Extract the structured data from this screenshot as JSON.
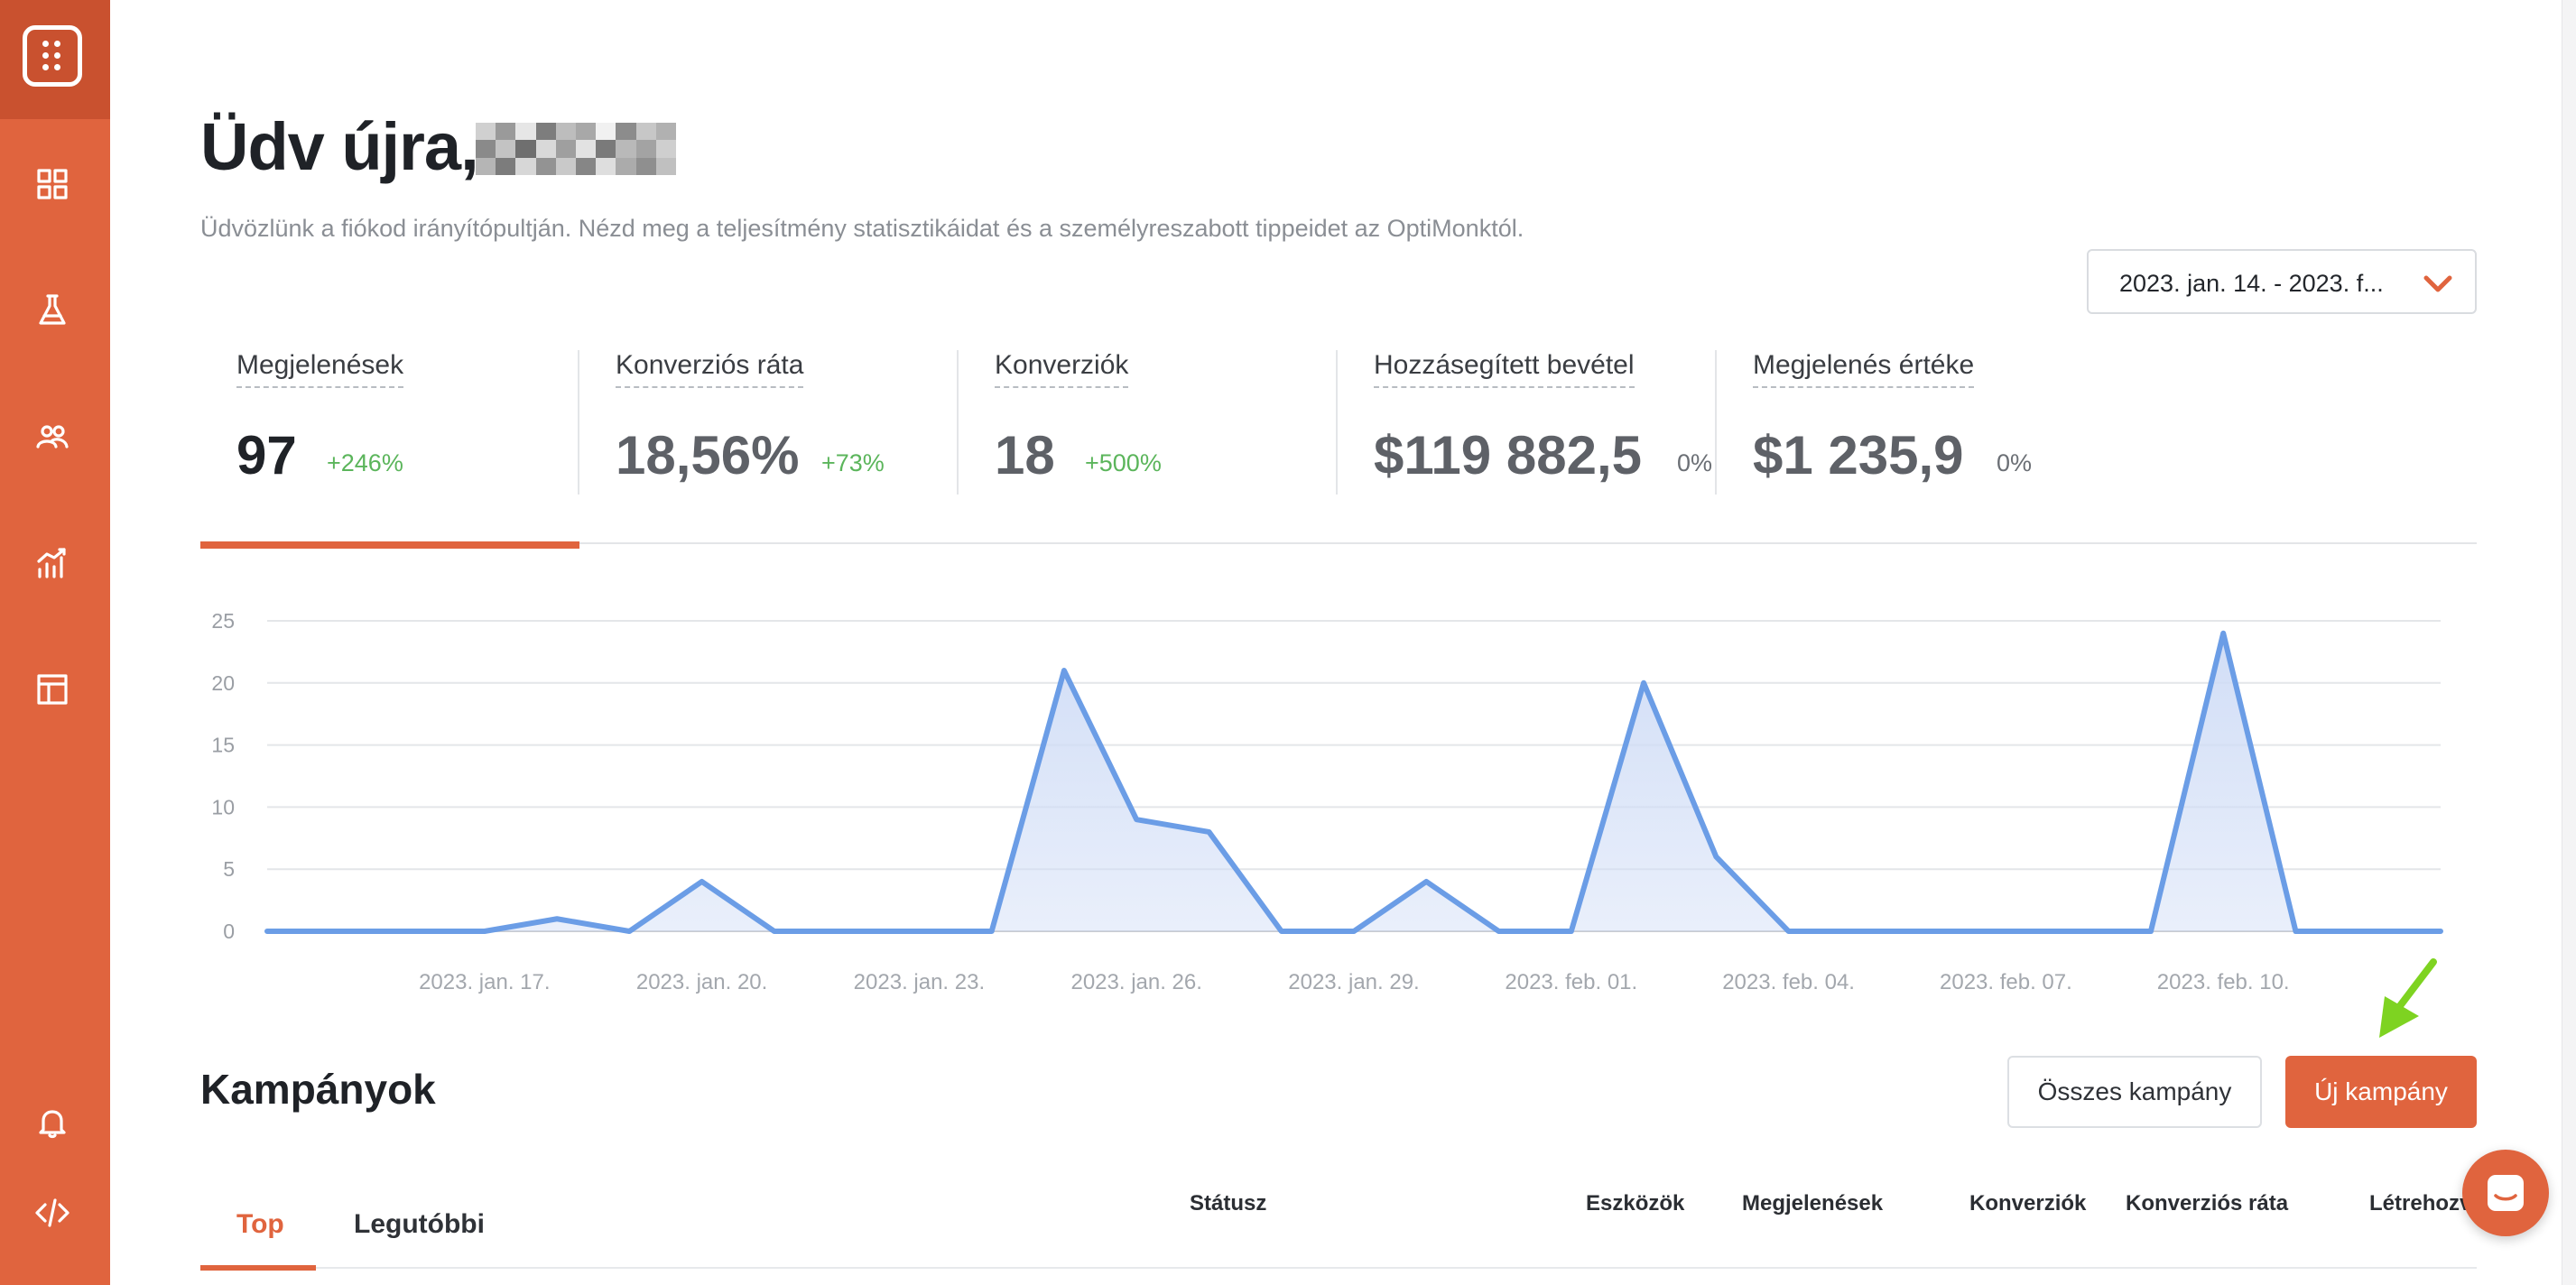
{
  "colors": {
    "accent": "#e0643e",
    "accent_dark": "#c9512f",
    "chart_line": "#6b9de6",
    "chart_fill": "#cfdcf6",
    "positive": "#5bb55b",
    "arrow": "#7ed321"
  },
  "sidebar": {
    "items": [
      {
        "name": "dashboard-icon"
      },
      {
        "name": "flask-icon"
      },
      {
        "name": "users-icon"
      },
      {
        "name": "analytics-icon"
      },
      {
        "name": "templates-icon"
      },
      {
        "name": "bell-icon"
      },
      {
        "name": "code-icon"
      }
    ]
  },
  "header": {
    "greeting": "Üdv újra,",
    "subtitle": "Üdvözlünk a fiókod irányítópultján. Nézd meg a teljesítmény statisztikáidat és a személyreszabott tippeidet az OptiMonktól.",
    "date_range": "2023. jan. 14. - 2023. f..."
  },
  "stats": [
    {
      "label": "Megjelenések",
      "value": "97",
      "delta": "+246%"
    },
    {
      "label": "Konverziós ráta",
      "value": "18,56%",
      "delta": "+73%"
    },
    {
      "label": "Konverziók",
      "value": "18",
      "delta": "+500%"
    },
    {
      "label": "Hozzásegített bevétel",
      "value": "$119 882,5",
      "delta": "0%"
    },
    {
      "label": "Megjelenés értéke",
      "value": "$1 235,9",
      "delta": "0%"
    }
  ],
  "chart_data": {
    "type": "area",
    "x": [
      "2023. jan. 14.",
      "2023. jan. 15.",
      "2023. jan. 16.",
      "2023. jan. 17.",
      "2023. jan. 18.",
      "2023. jan. 19.",
      "2023. jan. 20.",
      "2023. jan. 21.",
      "2023. jan. 22.",
      "2023. jan. 23.",
      "2023. jan. 24.",
      "2023. jan. 25.",
      "2023. jan. 26.",
      "2023. jan. 27.",
      "2023. jan. 28.",
      "2023. jan. 29.",
      "2023. jan. 30.",
      "2023. jan. 31.",
      "2023. feb. 01.",
      "2023. feb. 02.",
      "2023. feb. 03.",
      "2023. feb. 04.",
      "2023. feb. 05.",
      "2023. feb. 06.",
      "2023. feb. 07.",
      "2023. feb. 08.",
      "2023. feb. 09.",
      "2023. feb. 10.",
      "2023. feb. 11.",
      "2023. feb. 12.",
      "2023. feb. 13."
    ],
    "series": [
      {
        "values": [
          0,
          0,
          0,
          0,
          1,
          0,
          4,
          0,
          0,
          0,
          0,
          21,
          9,
          8,
          0,
          0,
          4,
          0,
          0,
          20,
          6,
          0,
          0,
          0,
          0,
          0,
          0,
          24,
          0,
          0,
          0
        ]
      }
    ],
    "xticks": [
      "2023. jan. 17.",
      "2023. jan. 20.",
      "2023. jan. 23.",
      "2023. jan. 26.",
      "2023. jan. 29.",
      "2023. feb. 01.",
      "2023. feb. 04.",
      "2023. feb. 07.",
      "2023. feb. 10."
    ],
    "yticks": [
      0,
      5,
      10,
      15,
      20,
      25
    ],
    "ylim": [
      0,
      25
    ],
    "grid": true,
    "legend": "none"
  },
  "campaigns": {
    "title": "Kampányok",
    "all_button": "Összes kampány",
    "new_button": "Új kampány",
    "tabs": [
      "Top",
      "Legutóbbi"
    ],
    "columns": [
      "Státusz",
      "Eszközök",
      "Megjelenések",
      "Konverziók",
      "Konverziós ráta",
      "Létrehozv"
    ]
  }
}
